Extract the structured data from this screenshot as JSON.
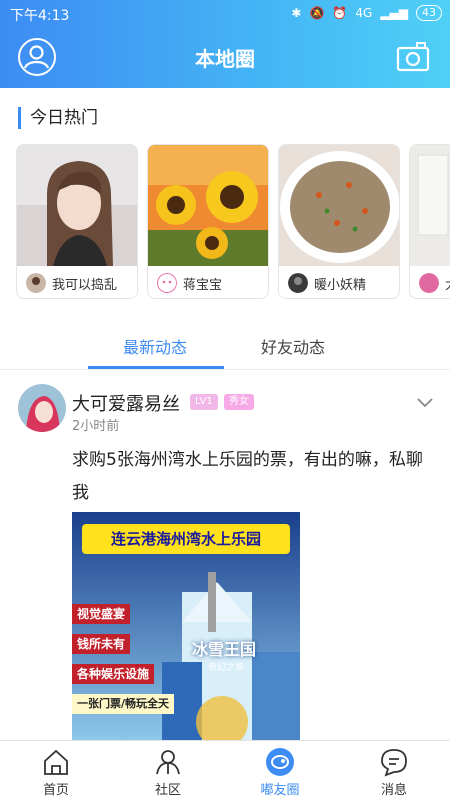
{
  "status_bar": {
    "time": "下午4:13",
    "network": "4G",
    "battery": "43"
  },
  "header": {
    "title": "本地圈",
    "profile_icon": "user-icon",
    "camera_icon": "camera-icon"
  },
  "hot": {
    "title": "今日热门",
    "cards": [
      {
        "user": "我可以捣乱"
      },
      {
        "user": "蒋宝宝"
      },
      {
        "user": "暖小妖精"
      },
      {
        "user": "大"
      }
    ]
  },
  "tabs": [
    {
      "label": "最新动态",
      "active": true
    },
    {
      "label": "好友动态",
      "active": false
    }
  ],
  "post": {
    "author": "大可爱露易丝",
    "level": "LV1",
    "tag": "秀女",
    "time": "2小时前",
    "text": "求购5张海州湾水上乐园的票，有出的嘛，私聊我",
    "image": {
      "title": "连云港海州湾水上乐园",
      "tags": [
        "视觉盛宴",
        "钱所未有",
        "各种娱乐设施",
        "一张门票/畅玩全天"
      ],
      "sign": "冰雪王国",
      "sign_sub": "奇幻之旅"
    }
  },
  "bottom_nav": [
    {
      "label": "首页",
      "icon": "home-icon"
    },
    {
      "label": "社区",
      "icon": "community-icon"
    },
    {
      "label": "嘟友圈",
      "icon": "friend-circle-icon",
      "active": true
    },
    {
      "label": "消息",
      "icon": "message-icon"
    }
  ],
  "colors": {
    "accent": "#3d8cf3",
    "header_gradient_end": "#4fd0f6",
    "badge_pink": "#f6a9e6"
  }
}
